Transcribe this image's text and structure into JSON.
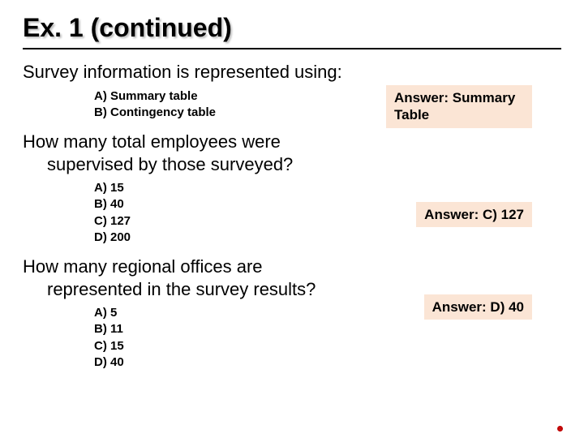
{
  "title": "Ex. 1 (continued)",
  "q1": {
    "text": "Survey information is represented using:",
    "options": {
      "a": "A) Summary table",
      "b": "B) Contingency table"
    },
    "answer_label": "Answer: Summary Table"
  },
  "q2": {
    "line1": "How many total employees were",
    "line2": "supervised by those surveyed?",
    "options": {
      "a": "A) 15",
      "b": "B) 40",
      "c": "C) 127",
      "d": "D) 200"
    },
    "answer_label": "Answer: C) 127"
  },
  "q3": {
    "line1": "How many regional offices are",
    "line2": "represented in the survey results?",
    "options": {
      "a": "A) 5",
      "b": "B) 11",
      "c": "C) 15",
      "d": "D) 40"
    },
    "answer_label": "Answer: D) 40"
  }
}
